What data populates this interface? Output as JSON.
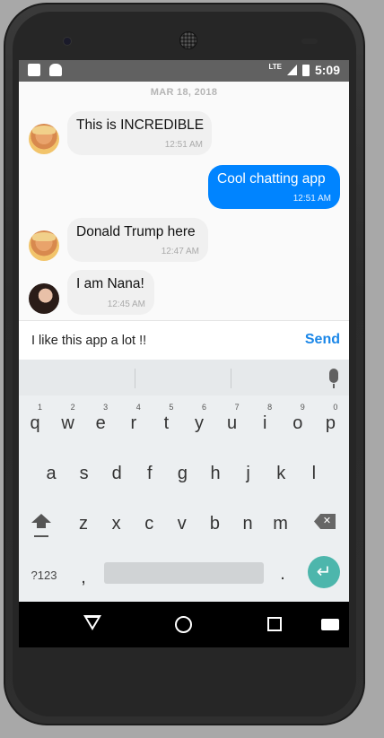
{
  "status_bar": {
    "network": "LTE",
    "time": "5:09"
  },
  "chat": {
    "date_header": "MAR 18, 2018",
    "messages": [
      {
        "direction": "incoming",
        "sender": "trump",
        "text": "This is INCREDIBLE",
        "time": "12:51 AM"
      },
      {
        "direction": "outgoing",
        "sender": "me",
        "text": "Cool chatting app",
        "time": "12:51 AM"
      },
      {
        "direction": "incoming",
        "sender": "trump",
        "text": "Donald Trump here",
        "time": "12:47 AM"
      },
      {
        "direction": "incoming",
        "sender": "nana",
        "text": "I am Nana!",
        "time": "12:45 AM"
      }
    ]
  },
  "composer": {
    "value": "I like this app a lot !!",
    "send_label": "Send"
  },
  "keyboard": {
    "row1": [
      {
        "key": "q",
        "hint": "1"
      },
      {
        "key": "w",
        "hint": "2"
      },
      {
        "key": "e",
        "hint": "3"
      },
      {
        "key": "r",
        "hint": "4"
      },
      {
        "key": "t",
        "hint": "5"
      },
      {
        "key": "y",
        "hint": "6"
      },
      {
        "key": "u",
        "hint": "7"
      },
      {
        "key": "i",
        "hint": "8"
      },
      {
        "key": "o",
        "hint": "9"
      },
      {
        "key": "p",
        "hint": "0"
      }
    ],
    "row2": [
      "a",
      "s",
      "d",
      "f",
      "g",
      "h",
      "j",
      "k",
      "l"
    ],
    "row3": [
      "z",
      "x",
      "c",
      "v",
      "b",
      "n",
      "m"
    ],
    "symbols_label": "?123",
    "comma": ",",
    "period": ".",
    "enter_icon": "↵"
  },
  "colors": {
    "outgoing_bubble": "#0084ff",
    "incoming_bubble": "#f0f0f0",
    "send": "#1b87e8",
    "enter_key": "#4db6ac"
  },
  "icons": [
    "sim-card-icon",
    "android-icon",
    "signal-icon",
    "battery-icon",
    "mic-icon",
    "shift-icon",
    "backspace-icon",
    "back-nav-icon",
    "home-nav-icon",
    "recents-nav-icon",
    "keyboard-switch-icon"
  ]
}
